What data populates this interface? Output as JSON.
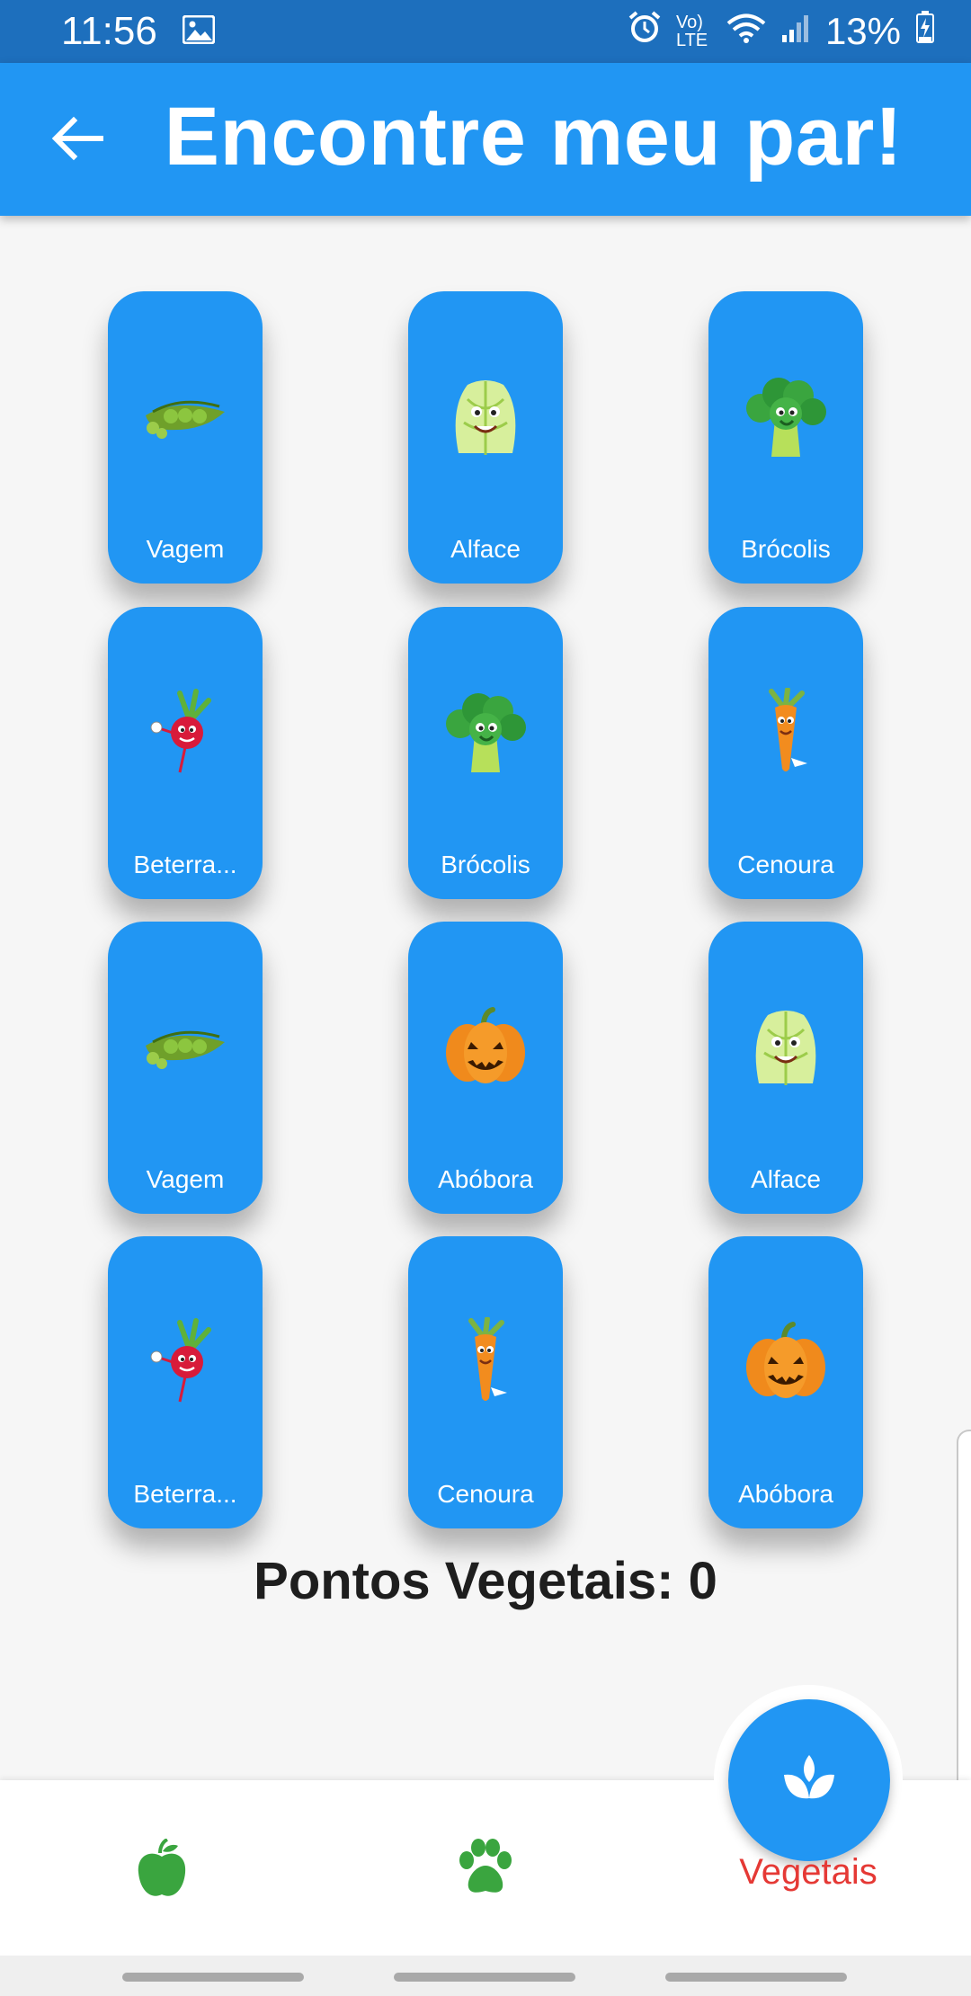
{
  "status_bar": {
    "time": "11:56",
    "battery": "13%",
    "network": "Vo) LTE"
  },
  "app_bar": {
    "title": "Encontre meu par!"
  },
  "cards": [
    {
      "label": "Vagem",
      "icon": "peas-icon"
    },
    {
      "label": "Alface",
      "icon": "lettuce-icon"
    },
    {
      "label": "Brócolis",
      "icon": "broccoli-icon"
    },
    {
      "label": "Beterra...",
      "icon": "beet-icon"
    },
    {
      "label": "Brócolis",
      "icon": "broccoli-icon"
    },
    {
      "label": "Cenoura",
      "icon": "carrot-icon"
    },
    {
      "label": "Vagem",
      "icon": "peas-icon"
    },
    {
      "label": "Abóbora",
      "icon": "pumpkin-icon"
    },
    {
      "label": "Alface",
      "icon": "lettuce-icon"
    },
    {
      "label": "Beterra...",
      "icon": "beet-icon"
    },
    {
      "label": "Cenoura",
      "icon": "carrot-icon"
    },
    {
      "label": "Abóbora",
      "icon": "pumpkin-icon"
    }
  ],
  "score": {
    "text": "Pontos Vegetais: 0"
  },
  "bottom_nav": {
    "items": [
      {
        "icon": "apple-icon"
      },
      {
        "icon": "paw-icon"
      },
      {
        "icon": "sprout-icon",
        "label": "Vegetais",
        "active": true
      }
    ],
    "active_label_color": "#e53935",
    "accent": "#2196f3"
  }
}
